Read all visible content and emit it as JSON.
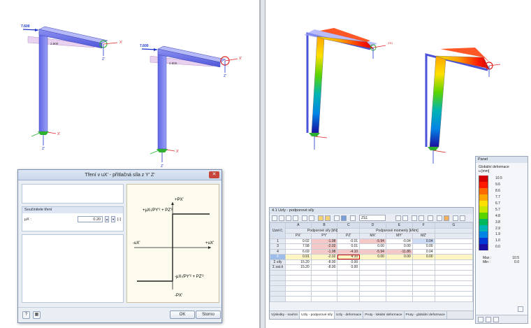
{
  "left_view": {
    "load_1": "7.600",
    "load_2": "7.600",
    "dim_1": "2.800",
    "dim_2": "2.800",
    "axis_x": "X'",
    "axis_y": "Y'",
    "axis_z": "Z'"
  },
  "right_view": {
    "sel_label": "ZS1"
  },
  "dialog": {
    "title": "Tření v uX' - přítlačná síla z Y' Z'",
    "close_glyph": "✕",
    "coef_group_title": "Součinitele tření",
    "coef_label": "μX :",
    "coef_value": "0.20",
    "coef_unit": "[-]",
    "ok": "OK",
    "cancel": "Storno",
    "plot": {
      "px_pos": "+PX'",
      "px_neg": "-PX'",
      "ux_pos": "+uX'",
      "ux_neg": "-uX'",
      "formula_top": "+μX√PY'² + PZ'²",
      "formula_bottom": "-μX√PY'² + PZ'²"
    }
  },
  "table_window": {
    "title": "4.1 Uzly - podporové síly",
    "case": "ZS1",
    "col_letters": [
      "A",
      "B",
      "C",
      "D",
      "E",
      "F",
      "G"
    ],
    "col_rownum": "Uzel č.",
    "group_forces": "Podporové síly [kN]",
    "group_moments": "Podporové momenty [kNm]",
    "col_names": [
      "PX'",
      "PY'",
      "PZ'",
      "MX'",
      "MY'",
      "MZ'"
    ],
    "rows": [
      {
        "node": "1",
        "vals": [
          "0.02",
          "-1.98",
          "-0.01",
          "-5.94",
          "-0.04",
          "0.04"
        ],
        "neg": [
          false,
          true,
          false,
          true,
          false,
          false
        ]
      },
      {
        "node": "3",
        "vals": [
          "7.58",
          "-2.02",
          "0.01",
          "0.00",
          "0.00",
          "0.00"
        ],
        "neg": [
          false,
          true,
          false,
          false,
          false,
          false
        ]
      },
      {
        "node": "4",
        "vals": [
          "6.69",
          "-1.98",
          "-4.10",
          "-5.94",
          "-11.86",
          "0.04"
        ],
        "neg": [
          false,
          true,
          true,
          true,
          true,
          false
        ]
      },
      {
        "node": "6",
        "vals": [
          "0.91",
          "-2.02",
          "4.10",
          "0.00",
          "0.00",
          "0.00"
        ],
        "neg": [
          false,
          true,
          false,
          false,
          false,
          false
        ],
        "selected": true
      },
      {
        "node": "Σ síly",
        "vals": [
          "15.20",
          "-8.00",
          "0.00",
          "",
          "",
          ""
        ],
        "neg": [
          false,
          false,
          false,
          false,
          false,
          false
        ]
      },
      {
        "node": "Σ zat.ti",
        "vals": [
          "15.20",
          "-8.00",
          "0.00",
          "",
          "",
          ""
        ],
        "neg": [
          false,
          false,
          false,
          false,
          false,
          false
        ]
      }
    ],
    "tabs": [
      "Výsledky - souhrn",
      "Uzly - podporové síly",
      "Uzly - deformace",
      "Pruty - lokální deformace",
      "Pruty - globální deformace"
    ]
  },
  "panel": {
    "title": "Panel",
    "subtitle": "Globální deformace",
    "unit": "u [mm]",
    "legend": [
      {
        "value": "10.5",
        "color": "#d40000"
      },
      {
        "value": "9.6",
        "color": "#ff1a00"
      },
      {
        "value": "8.6",
        "color": "#ff6a00"
      },
      {
        "value": "7.7",
        "color": "#ffa500"
      },
      {
        "value": "6.7",
        "color": "#ffe000"
      },
      {
        "value": "5.7",
        "color": "#c8e600"
      },
      {
        "value": "4.8",
        "color": "#5ad400"
      },
      {
        "value": "3.8",
        "color": "#00b85c"
      },
      {
        "value": "2.9",
        "color": "#00b4b4"
      },
      {
        "value": "1.9",
        "color": "#0084e6"
      },
      {
        "value": "1.0",
        "color": "#0038d8"
      },
      {
        "value": "0.0",
        "color": "#1a0fa0"
      }
    ],
    "max_label": "Max :",
    "max_value": "10.5",
    "min_label": "Min :",
    "min_value": "0.0"
  }
}
